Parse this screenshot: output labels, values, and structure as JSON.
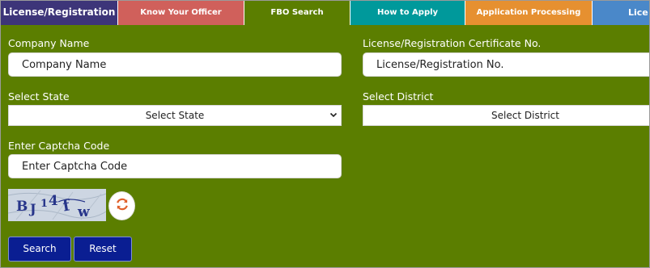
{
  "tabs": [
    {
      "label": "License/Registration",
      "color": "#3d3579"
    },
    {
      "label": "Know Your Officer",
      "color": "#d0605b"
    },
    {
      "label": "FBO Search",
      "color": "#5b7e00",
      "active": true
    },
    {
      "label": "How to Apply",
      "color": "#00999b"
    },
    {
      "label": "Application Processing",
      "color": "#e69030"
    },
    {
      "label": "Lice",
      "color": "#4a88c9"
    }
  ],
  "form": {
    "company_name": {
      "label": "Company Name",
      "placeholder": "Company Name"
    },
    "license_no": {
      "label": "License/Registration Certificate No.",
      "placeholder": "License/Registration No."
    },
    "state": {
      "label": "Select State",
      "selected": "Select State"
    },
    "district": {
      "label": "Select District",
      "selected": "Select District"
    },
    "captcha": {
      "label": "Enter Captcha Code",
      "placeholder": "Enter Captcha Code"
    }
  },
  "buttons": {
    "search": "Search",
    "reset": "Reset"
  },
  "colors": {
    "background": "#5b7e00",
    "button": "#0a1e92",
    "refresh_icon": "#e0602b"
  }
}
